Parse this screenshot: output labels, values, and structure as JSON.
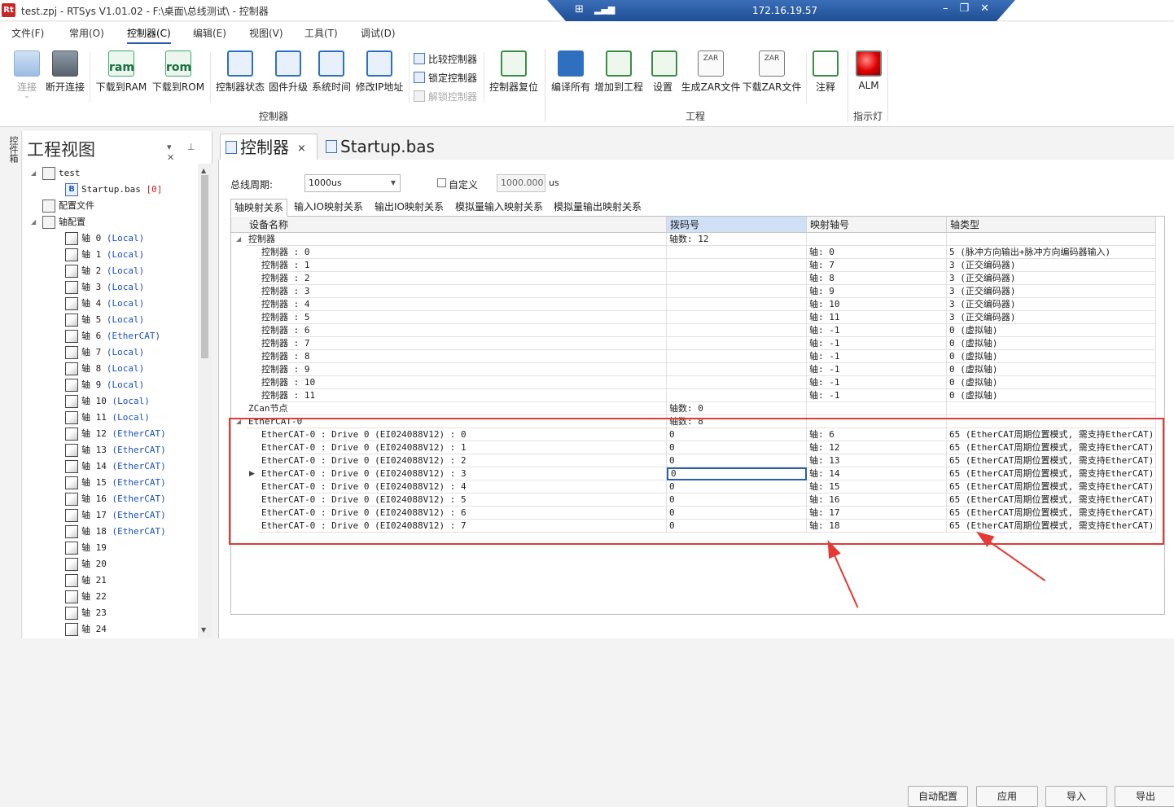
{
  "window": {
    "logo": "Rt",
    "title": "test.zpj - RTSys V1.01.02 - F:\\桌面\\总线测试\\ - 控制器"
  },
  "remote": {
    "ip": "172.16.19.57"
  },
  "menu": [
    "文件(F)",
    "常用(O)",
    "控制器(C)",
    "编辑(E)",
    "视图(V)",
    "工具(T)",
    "调试(D)"
  ],
  "ribbon": {
    "connect": "连接",
    "disconnect": "断开连接",
    "download_ram": "下载到RAM",
    "download_rom": "下载到ROM",
    "ram_text": "ram",
    "rom_text": "rom",
    "controller_status": "控制器状态",
    "firmware_upgrade": "固件升级",
    "system_time": "系统时间",
    "modify_ip": "修改IP地址",
    "compare_controller": "比较控制器",
    "lock_controller": "锁定控制器",
    "unlock_controller": "解锁控制器",
    "reset_controller": "控制器复位",
    "compile_all": "编译所有",
    "add_to_project": "增加到工程",
    "settings": "设置",
    "gen_zar": "生成ZAR文件",
    "download_zar": "下载ZAR文件",
    "zar_text": "ZAR",
    "comment": "注释",
    "alm": "ALM",
    "group_controller": "控制器",
    "group_project": "工程",
    "group_indicator": "指示灯"
  },
  "toolbox": {
    "label": "控件箱"
  },
  "project_panel": {
    "title": "工程视图",
    "tree": [
      {
        "label": "test",
        "sub": "",
        "red": "",
        "level": 1,
        "icon": "folder",
        "expand": "◢"
      },
      {
        "label": "Startup.bas ",
        "sub": "",
        "red": "[0]",
        "level": 2,
        "icon": "file",
        "expand": ""
      },
      {
        "label": "配置文件",
        "sub": "",
        "red": "",
        "level": 1,
        "icon": "gear",
        "expand": ""
      },
      {
        "label": "轴配置",
        "sub": "",
        "red": "",
        "level": 1,
        "icon": "gear",
        "expand": "◢"
      },
      {
        "label": "轴 0 ",
        "sub": "(Local)",
        "red": "",
        "level": 2,
        "icon": "axis",
        "expand": ""
      },
      {
        "label": "轴 1 ",
        "sub": "(Local)",
        "red": "",
        "level": 2,
        "icon": "axis",
        "expand": ""
      },
      {
        "label": "轴 2 ",
        "sub": "(Local)",
        "red": "",
        "level": 2,
        "icon": "axis",
        "expand": ""
      },
      {
        "label": "轴 3 ",
        "sub": "(Local)",
        "red": "",
        "level": 2,
        "icon": "axis",
        "expand": ""
      },
      {
        "label": "轴 4 ",
        "sub": "(Local)",
        "red": "",
        "level": 2,
        "icon": "axis",
        "expand": ""
      },
      {
        "label": "轴 5 ",
        "sub": "(Local)",
        "red": "",
        "level": 2,
        "icon": "axis",
        "expand": ""
      },
      {
        "label": "轴 6 ",
        "sub": "(EtherCAT)",
        "red": "",
        "level": 2,
        "icon": "axis",
        "expand": ""
      },
      {
        "label": "轴 7 ",
        "sub": "(Local)",
        "red": "",
        "level": 2,
        "icon": "axis",
        "expand": ""
      },
      {
        "label": "轴 8 ",
        "sub": "(Local)",
        "red": "",
        "level": 2,
        "icon": "axis",
        "expand": ""
      },
      {
        "label": "轴 9 ",
        "sub": "(Local)",
        "red": "",
        "level": 2,
        "icon": "axis",
        "expand": ""
      },
      {
        "label": "轴 10 ",
        "sub": "(Local)",
        "red": "",
        "level": 2,
        "icon": "axis",
        "expand": ""
      },
      {
        "label": "轴 11 ",
        "sub": "(Local)",
        "red": "",
        "level": 2,
        "icon": "axis",
        "expand": ""
      },
      {
        "label": "轴 12 ",
        "sub": "(EtherCAT)",
        "red": "",
        "level": 2,
        "icon": "axis",
        "expand": ""
      },
      {
        "label": "轴 13 ",
        "sub": "(EtherCAT)",
        "red": "",
        "level": 2,
        "icon": "axis",
        "expand": ""
      },
      {
        "label": "轴 14 ",
        "sub": "(EtherCAT)",
        "red": "",
        "level": 2,
        "icon": "axis",
        "expand": ""
      },
      {
        "label": "轴 15 ",
        "sub": "(EtherCAT)",
        "red": "",
        "level": 2,
        "icon": "axis",
        "expand": ""
      },
      {
        "label": "轴 16 ",
        "sub": "(EtherCAT)",
        "red": "",
        "level": 2,
        "icon": "axis",
        "expand": ""
      },
      {
        "label": "轴 17 ",
        "sub": "(EtherCAT)",
        "red": "",
        "level": 2,
        "icon": "axis",
        "expand": ""
      },
      {
        "label": "轴 18 ",
        "sub": "(EtherCAT)",
        "red": "",
        "level": 2,
        "icon": "axis",
        "expand": ""
      },
      {
        "label": "轴 19",
        "sub": "",
        "red": "",
        "level": 2,
        "icon": "axis",
        "expand": ""
      },
      {
        "label": "轴 20",
        "sub": "",
        "red": "",
        "level": 2,
        "icon": "axis",
        "expand": ""
      },
      {
        "label": "轴 21",
        "sub": "",
        "red": "",
        "level": 2,
        "icon": "axis",
        "expand": ""
      },
      {
        "label": "轴 22",
        "sub": "",
        "red": "",
        "level": 2,
        "icon": "axis",
        "expand": ""
      },
      {
        "label": "轴 23",
        "sub": "",
        "red": "",
        "level": 2,
        "icon": "axis",
        "expand": ""
      },
      {
        "label": "轴 24",
        "sub": "",
        "red": "",
        "level": 2,
        "icon": "axis",
        "expand": ""
      }
    ]
  },
  "doc_tabs": [
    {
      "label": "控制器",
      "close": "×"
    },
    {
      "label": "Startup.bas",
      "close": ""
    }
  ],
  "controller": {
    "cycle_label": "总线周期:",
    "cycle_value": "1000us",
    "custom_label": "自定义",
    "custom_value": "1000.000",
    "unit": "us",
    "tabs": [
      "轴映射关系",
      "输入IO映射关系",
      "输出IO映射关系",
      "模拟量输入映射关系",
      "模拟量输出映射关系"
    ],
    "columns": [
      "设备名称",
      "拨码号",
      "映射轴号",
      "轴类型"
    ],
    "rows": [
      {
        "level": 0,
        "expand": "◢",
        "name": "控制器",
        "dip": "轴数: 12",
        "axis": "",
        "type": ""
      },
      {
        "level": 1,
        "expand": "",
        "name": "控制器 : 0",
        "dip": "",
        "axis": "轴: 0",
        "type": "5 (脉冲方向输出+脉冲方向编码器输入)"
      },
      {
        "level": 1,
        "expand": "",
        "name": "控制器 : 1",
        "dip": "",
        "axis": "轴: 7",
        "type": "3 (正交编码器)"
      },
      {
        "level": 1,
        "expand": "",
        "name": "控制器 : 2",
        "dip": "",
        "axis": "轴: 8",
        "type": "3 (正交编码器)"
      },
      {
        "level": 1,
        "expand": "",
        "name": "控制器 : 3",
        "dip": "",
        "axis": "轴: 9",
        "type": "3 (正交编码器)"
      },
      {
        "level": 1,
        "expand": "",
        "name": "控制器 : 4",
        "dip": "",
        "axis": "轴: 10",
        "type": "3 (正交编码器)"
      },
      {
        "level": 1,
        "expand": "",
        "name": "控制器 : 5",
        "dip": "",
        "axis": "轴: 11",
        "type": "3 (正交编码器)"
      },
      {
        "level": 1,
        "expand": "",
        "name": "控制器 : 6",
        "dip": "",
        "axis": "轴: -1",
        "type": "0 (虚拟轴)"
      },
      {
        "level": 1,
        "expand": "",
        "name": "控制器 : 7",
        "dip": "",
        "axis": "轴: -1",
        "type": "0 (虚拟轴)"
      },
      {
        "level": 1,
        "expand": "",
        "name": "控制器 : 8",
        "dip": "",
        "axis": "轴: -1",
        "type": "0 (虚拟轴)"
      },
      {
        "level": 1,
        "expand": "",
        "name": "控制器 : 9",
        "dip": "",
        "axis": "轴: -1",
        "type": "0 (虚拟轴)"
      },
      {
        "level": 1,
        "expand": "",
        "name": "控制器 : 10",
        "dip": "",
        "axis": "轴: -1",
        "type": "0 (虚拟轴)"
      },
      {
        "level": 1,
        "expand": "",
        "name": "控制器 : 11",
        "dip": "",
        "axis": "轴: -1",
        "type": "0 (虚拟轴)"
      },
      {
        "level": 0,
        "expand": "",
        "name": "ZCan节点",
        "dip": "轴数: 0",
        "axis": "",
        "type": ""
      },
      {
        "level": 0,
        "expand": "◢",
        "name": "EtherCAT-0",
        "dip": "轴数: 8",
        "axis": "",
        "type": ""
      },
      {
        "level": 1,
        "expand": "",
        "name": "EtherCAT-0 : Drive 0 (EI024088V12) : 0",
        "dip": "0",
        "axis": "轴: 6",
        "type": "65 (EtherCAT周期位置模式, 需支持EtherCAT)"
      },
      {
        "level": 1,
        "expand": "",
        "name": "EtherCAT-0 : Drive 0 (EI024088V12) : 1",
        "dip": "0",
        "axis": "轴: 12",
        "type": "65 (EtherCAT周期位置模式, 需支持EtherCAT)"
      },
      {
        "level": 1,
        "expand": "",
        "name": "EtherCAT-0 : Drive 0 (EI024088V12) : 2",
        "dip": "0",
        "axis": "轴: 13",
        "type": "65 (EtherCAT周期位置模式, 需支持EtherCAT)"
      },
      {
        "level": 1,
        "expand": "",
        "name": "EtherCAT-0 : Drive 0 (EI024088V12) : 3",
        "dip": "0",
        "axis": "轴: 14",
        "type": "65 (EtherCAT周期位置模式, 需支持EtherCAT)",
        "current": true
      },
      {
        "level": 1,
        "expand": "",
        "name": "EtherCAT-0 : Drive 0 (EI024088V12) : 4",
        "dip": "0",
        "axis": "轴: 15",
        "type": "65 (EtherCAT周期位置模式, 需支持EtherCAT)"
      },
      {
        "level": 1,
        "expand": "",
        "name": "EtherCAT-0 : Drive 0 (EI024088V12) : 5",
        "dip": "0",
        "axis": "轴: 16",
        "type": "65 (EtherCAT周期位置模式, 需支持EtherCAT)"
      },
      {
        "level": 1,
        "expand": "",
        "name": "EtherCAT-0 : Drive 0 (EI024088V12) : 6",
        "dip": "0",
        "axis": "轴: 17",
        "type": "65 (EtherCAT周期位置模式, 需支持EtherCAT)"
      },
      {
        "level": 1,
        "expand": "",
        "name": "EtherCAT-0 : Drive 0 (EI024088V12) : 7",
        "dip": "0",
        "axis": "轴: 18",
        "type": "65 (EtherCAT周期位置模式, 需支持EtherCAT)"
      }
    ],
    "buttons": [
      "自动配置",
      "应用",
      "导入",
      "导出"
    ]
  },
  "colors": {
    "annotation": "#e53935",
    "accent": "#2a5db0"
  }
}
